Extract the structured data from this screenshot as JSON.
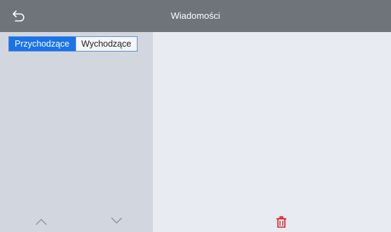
{
  "header": {
    "title": "Wiadomości",
    "back_icon": "back-arrow-icon"
  },
  "sidebar": {
    "tabs": [
      {
        "label": "Przychodzące",
        "active": true
      },
      {
        "label": "Wychodzące",
        "active": false
      }
    ],
    "nav": {
      "up_icon": "chevron-up-icon",
      "down_icon": "chevron-down-icon"
    }
  },
  "content": {
    "delete_icon": "trash-icon"
  },
  "colors": {
    "topbar": "#6f737a",
    "sidebar": "#d2d7df",
    "content": "#e8ebf2",
    "accent": "#1a73e8",
    "delete": "#e02020"
  }
}
